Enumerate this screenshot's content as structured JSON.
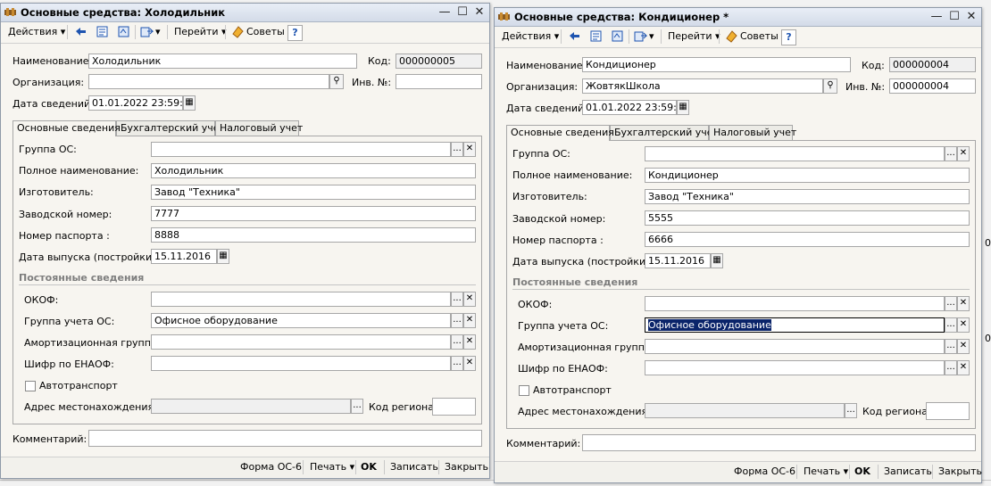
{
  "windows": [
    {
      "title": "Основные средства: Холодильник",
      "toolbar": {
        "actions": "Действия",
        "goto": "Перейти",
        "tips": "Советы",
        "help": "?"
      },
      "header": {
        "name_label": "Наименование:",
        "name_value": "Холодильник",
        "code_label": "Код:",
        "code_value": "000000005",
        "org_label": "Организация:",
        "org_value": "",
        "inv_label": "Инв. №:",
        "inv_value": "",
        "date_label": "Дата сведений:",
        "date_value": "01.01.2022 23:59:59"
      },
      "tabs": [
        "Основные сведения",
        "Бухгалтерский учет",
        "Налоговый учет"
      ],
      "fields": {
        "group_label": "Группа ОС:",
        "group_value": "",
        "fullname_label": "Полное наименование:",
        "fullname_value": "Холодильник",
        "maker_label": "Изготовитель:",
        "maker_value": "Завод \"Техника\"",
        "serial_label": "Заводской номер:",
        "serial_value": "7777",
        "passport_label": "Номер паспорта :",
        "passport_value": "8888",
        "release_label": "Дата выпуска (постройки):",
        "release_value": "15.11.2016"
      },
      "permanent": {
        "section_title": "Постоянные сведения",
        "okof_label": "ОКОФ:",
        "okof_value": "",
        "accgroup_label": "Группа учета ОС:",
        "accgroup_value": "Офисное оборудование",
        "amort_label": "Амортизационная группа:",
        "amort_value": "",
        "enaof_label": "Шифр по ЕНАОФ:",
        "enaof_value": "",
        "auto_label": "Автотранспорт",
        "address_label": "Адрес местонахождения:",
        "address_value": "",
        "region_label": "Код региона:",
        "region_value": ""
      },
      "comment_label": "Комментарий:",
      "comment_value": "",
      "footer": {
        "form": "Форма ОС-6",
        "print": "Печать",
        "ok": "OK",
        "save": "Записать",
        "close": "Закрыть"
      }
    },
    {
      "title": "Основные средства: Кондиционер *",
      "toolbar": {
        "actions": "Действия",
        "goto": "Перейти",
        "tips": "Советы",
        "help": "?"
      },
      "header": {
        "name_label": "Наименование:",
        "name_value": "Кондиционер",
        "code_label": "Код:",
        "code_value": "000000004",
        "org_label": "Организация:",
        "org_value": "ЖовтякШкола",
        "inv_label": "Инв. №:",
        "inv_value": "000000004",
        "date_label": "Дата сведений:",
        "date_value": "01.01.2022 23:59:59"
      },
      "tabs": [
        "Основные сведения",
        "Бухгалтерский учет",
        "Налоговый учет"
      ],
      "fields": {
        "group_label": "Группа ОС:",
        "group_value": "",
        "fullname_label": "Полное наименование:",
        "fullname_value": "Кондиционер",
        "maker_label": "Изготовитель:",
        "maker_value": "Завод \"Техника\"",
        "serial_label": "Заводской номер:",
        "serial_value": "5555",
        "passport_label": "Номер паспорта :",
        "passport_value": "6666",
        "release_label": "Дата выпуска (постройки):",
        "release_value": "15.11.2016"
      },
      "permanent": {
        "section_title": "Постоянные сведения",
        "okof_label": "ОКОФ:",
        "okof_value": "",
        "accgroup_label": "Группа учета ОС:",
        "accgroup_value": "Офисное оборудование",
        "amort_label": "Амортизационная группа:",
        "amort_value": "",
        "enaof_label": "Шифр по ЕНАОФ:",
        "enaof_value": "",
        "auto_label": "Автотранспорт",
        "address_label": "Адрес местонахождения:",
        "address_value": "",
        "region_label": "Код региона:",
        "region_value": ""
      },
      "comment_label": "Комментарий:",
      "comment_value": "",
      "footer": {
        "form": "Форма ОС-6",
        "print": "Печать",
        "ok": "OK",
        "save": "Записать",
        "close": "Закрыть"
      }
    }
  ],
  "background_fragments": {
    "frag1": "0",
    "frag2": "0"
  },
  "colors": {
    "selection": "#0a246a",
    "section_title": "#7e7e7e"
  }
}
